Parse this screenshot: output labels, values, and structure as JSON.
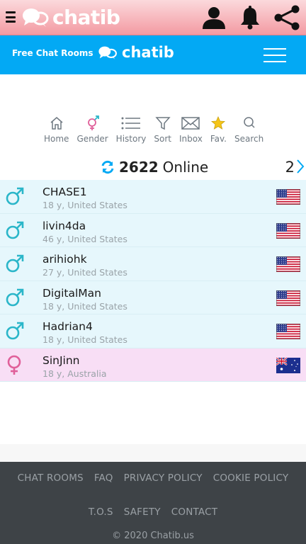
{
  "brand": {
    "name": "chatib",
    "tagline": "Free Chat Rooms"
  },
  "toolbar": [
    {
      "label": "Home",
      "icon": "home-icon"
    },
    {
      "label": "Gender",
      "icon": "gender-icon"
    },
    {
      "label": "History",
      "icon": "history-icon"
    },
    {
      "label": "Sort",
      "icon": "filter-icon"
    },
    {
      "label": "Inbox",
      "icon": "inbox-icon"
    },
    {
      "label": "Fav.",
      "icon": "star-icon"
    },
    {
      "label": "Search",
      "icon": "search-icon"
    }
  ],
  "online": {
    "count": "2622",
    "label": "Online",
    "page": "2"
  },
  "users": [
    {
      "name": "CHASE1",
      "meta": "18 y, United States",
      "gender": "male",
      "flag": "us"
    },
    {
      "name": "livin4da",
      "meta": "46 y, United States",
      "gender": "male",
      "flag": "us"
    },
    {
      "name": "arihiohk",
      "meta": "27 y, United States",
      "gender": "male",
      "flag": "us"
    },
    {
      "name": "DigitalMan",
      "meta": "18 y, United States",
      "gender": "male",
      "flag": "us"
    },
    {
      "name": "Hadrian4",
      "meta": "18 y, United States",
      "gender": "male",
      "flag": "us"
    },
    {
      "name": "SinJinn",
      "meta": "18 y, Australia",
      "gender": "female",
      "flag": "au"
    }
  ],
  "footer": {
    "row1": [
      "CHAT ROOMS",
      "FAQ",
      "PRIVACY POLICY",
      "COOKIE POLICY"
    ],
    "row2": [
      "T.O.S",
      "SAFETY",
      "CONTACT"
    ],
    "copyright": "© 2020 Chatib.us"
  },
  "colors": {
    "male": "#2bb6c9",
    "female": "#e0609a",
    "nav": "#03a9f4",
    "top": "#f39aa2"
  }
}
